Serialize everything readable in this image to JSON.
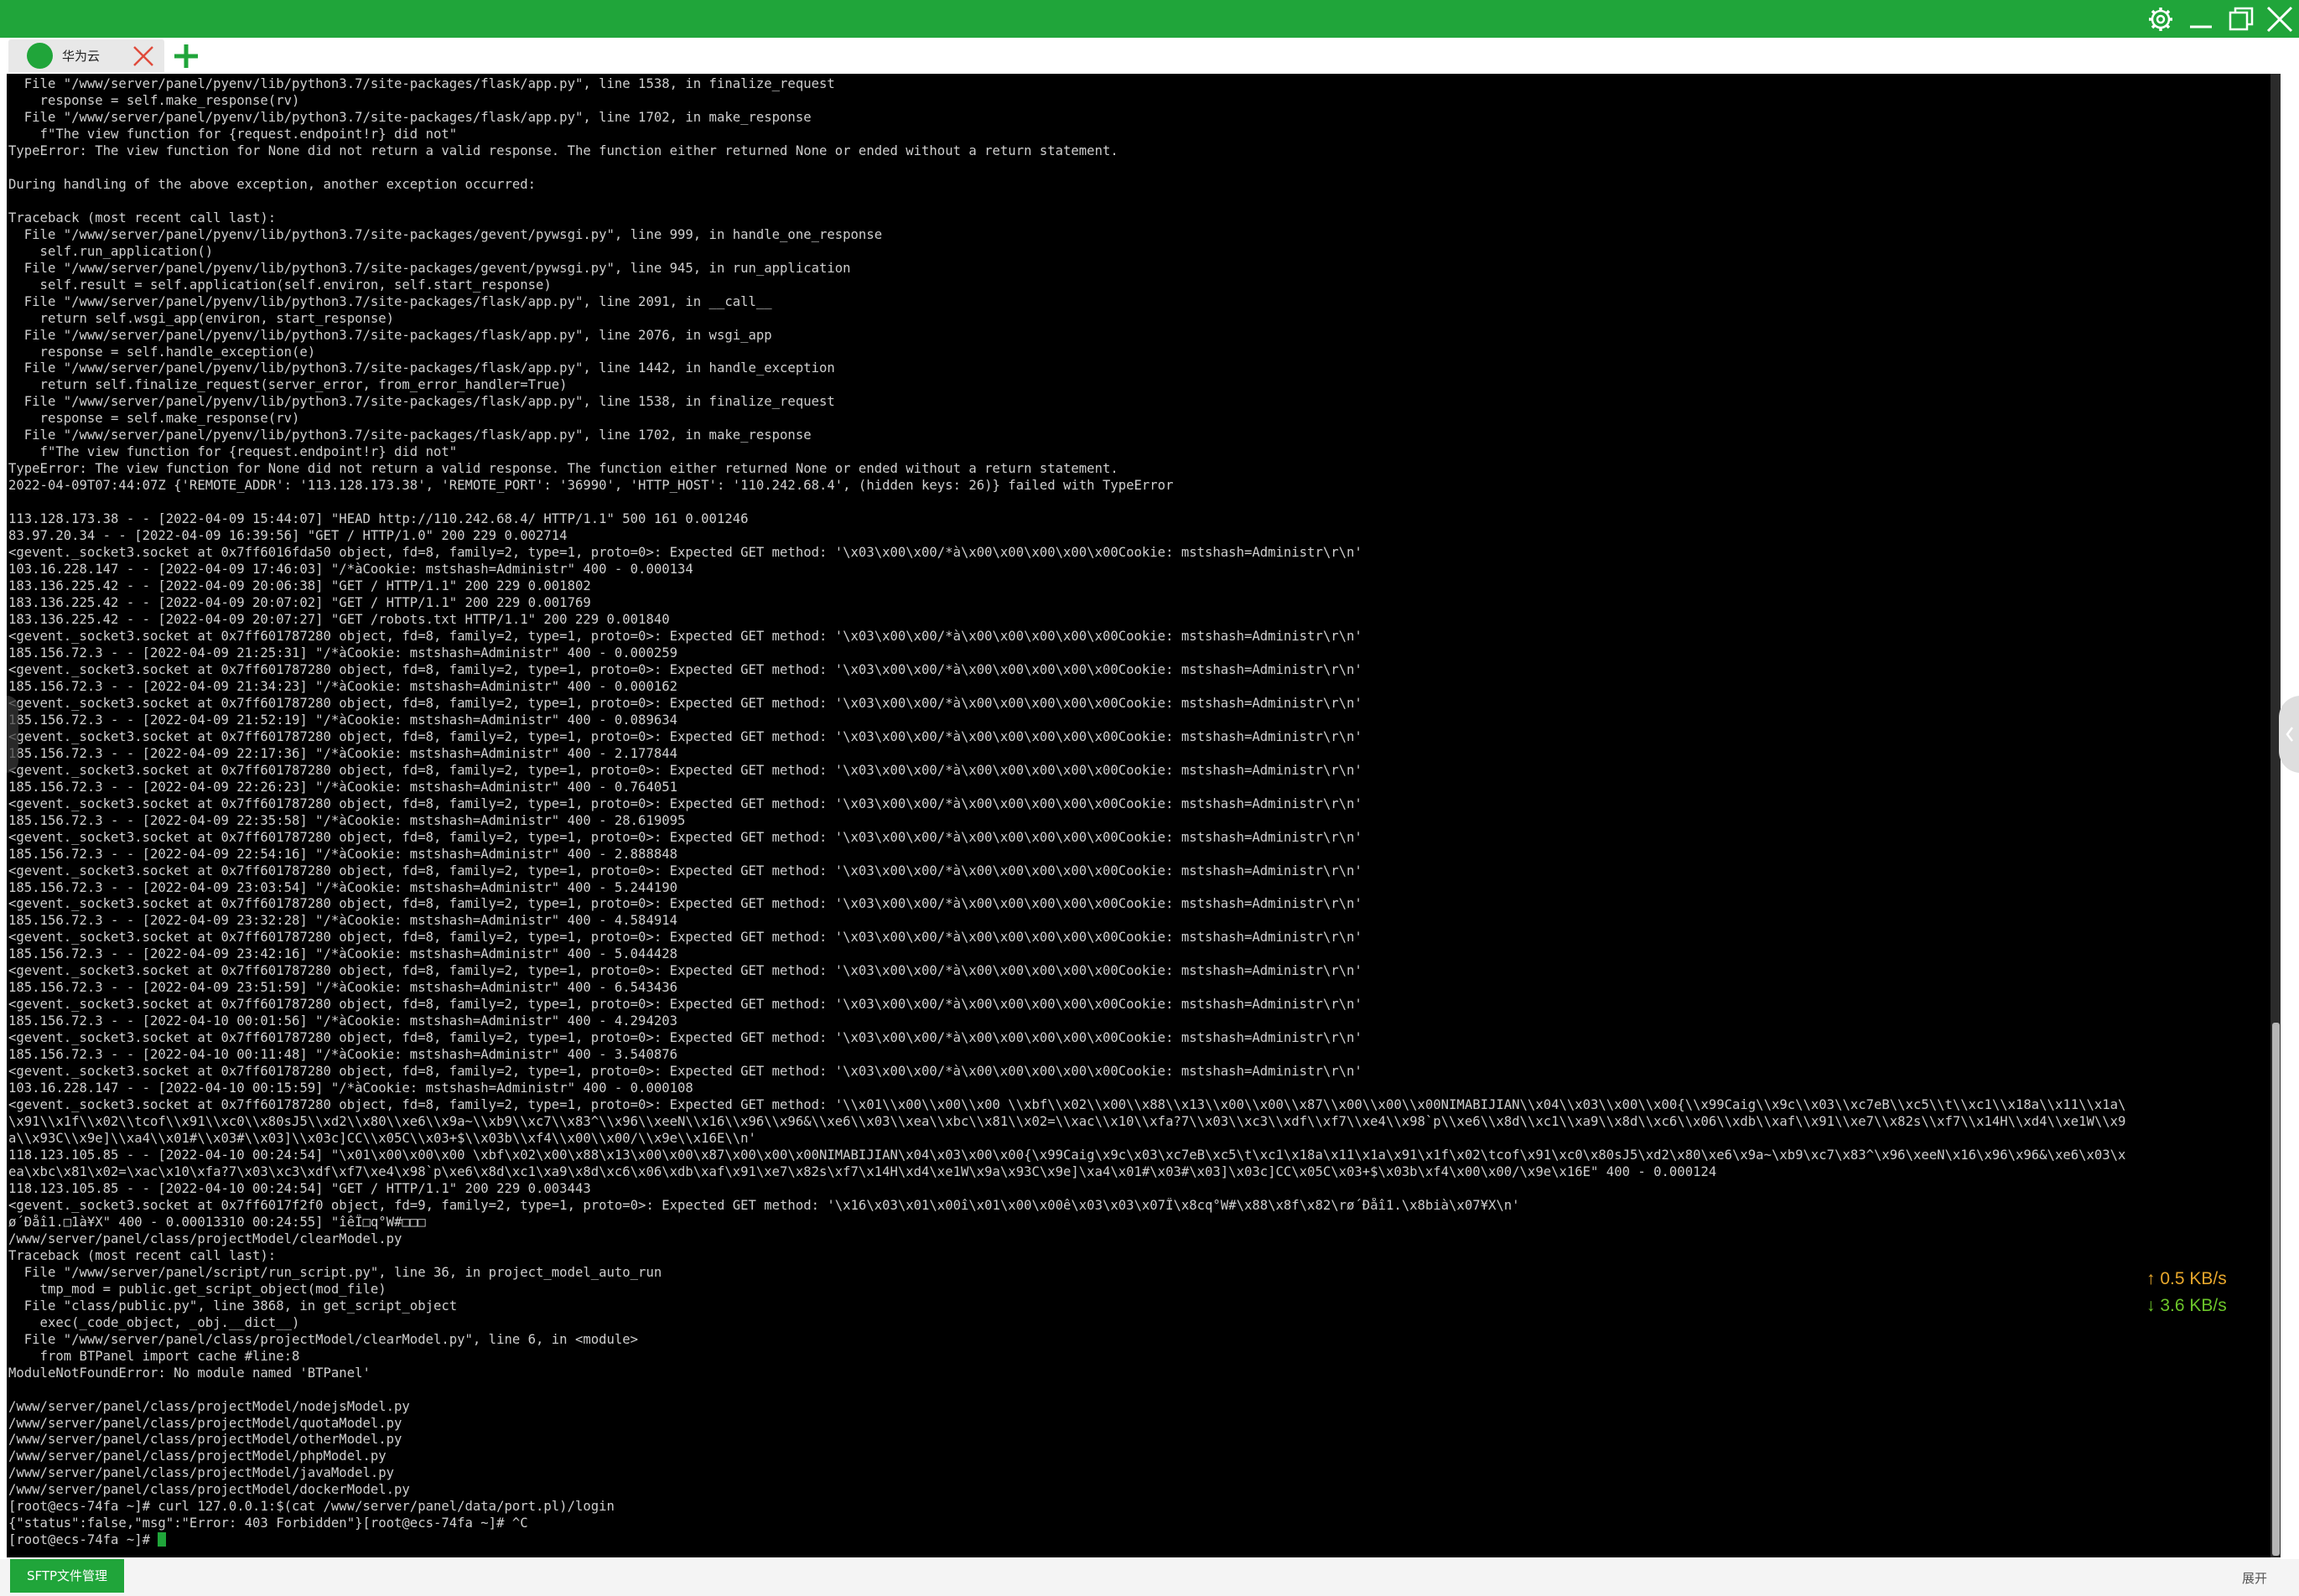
{
  "colors": {
    "accent": "#20a53a",
    "terminal_bg": "#000000",
    "terminal_fg": "#cfcfcf",
    "upload": "#e8a72b",
    "download": "#6cc62a"
  },
  "titlebar": {
    "icons": [
      "gear-icon",
      "minimize-icon",
      "restore-icon",
      "close-icon"
    ]
  },
  "tabs": [
    {
      "label": "华为云",
      "icon": "server-dot-icon",
      "close_icon": "close-icon"
    }
  ],
  "add_tab_icon": "plus-icon",
  "terminal": {
    "lines": [
      "  File \"/www/server/panel/pyenv/lib/python3.7/site-packages/flask/app.py\", line 1538, in finalize_request",
      "    response = self.make_response(rv)",
      "  File \"/www/server/panel/pyenv/lib/python3.7/site-packages/flask/app.py\", line 1702, in make_response",
      "    f\"The view function for {request.endpoint!r} did not\"",
      "TypeError: The view function for None did not return a valid response. The function either returned None or ended without a return statement.",
      "",
      "During handling of the above exception, another exception occurred:",
      "",
      "Traceback (most recent call last):",
      "  File \"/www/server/panel/pyenv/lib/python3.7/site-packages/gevent/pywsgi.py\", line 999, in handle_one_response",
      "    self.run_application()",
      "  File \"/www/server/panel/pyenv/lib/python3.7/site-packages/gevent/pywsgi.py\", line 945, in run_application",
      "    self.result = self.application(self.environ, self.start_response)",
      "  File \"/www/server/panel/pyenv/lib/python3.7/site-packages/flask/app.py\", line 2091, in __call__",
      "    return self.wsgi_app(environ, start_response)",
      "  File \"/www/server/panel/pyenv/lib/python3.7/site-packages/flask/app.py\", line 2076, in wsgi_app",
      "    response = self.handle_exception(e)",
      "  File \"/www/server/panel/pyenv/lib/python3.7/site-packages/flask/app.py\", line 1442, in handle_exception",
      "    return self.finalize_request(server_error, from_error_handler=True)",
      "  File \"/www/server/panel/pyenv/lib/python3.7/site-packages/flask/app.py\", line 1538, in finalize_request",
      "    response = self.make_response(rv)",
      "  File \"/www/server/panel/pyenv/lib/python3.7/site-packages/flask/app.py\", line 1702, in make_response",
      "    f\"The view function for {request.endpoint!r} did not\"",
      "TypeError: The view function for None did not return a valid response. The function either returned None or ended without a return statement.",
      "2022-04-09T07:44:07Z {'REMOTE_ADDR': '113.128.173.38', 'REMOTE_PORT': '36990', 'HTTP_HOST': '110.242.68.4', (hidden keys: 26)} failed with TypeError",
      "",
      "113.128.173.38 - - [2022-04-09 15:44:07] \"HEAD http://110.242.68.4/ HTTP/1.1\" 500 161 0.001246",
      "83.97.20.34 - - [2022-04-09 16:39:56] \"GET / HTTP/1.0\" 200 229 0.002714",
      "<gevent._socket3.socket at 0x7ff6016fda50 object, fd=8, family=2, type=1, proto=0>: Expected GET method: '\\x03\\x00\\x00/*à\\x00\\x00\\x00\\x00\\x00Cookie: mstshash=Administr\\r\\n'",
      "103.16.228.147 - - [2022-04-09 17:46:03] \"/*àCookie: mstshash=Administr\" 400 - 0.000134",
      "183.136.225.42 - - [2022-04-09 20:06:38] \"GET / HTTP/1.1\" 200 229 0.001802",
      "183.136.225.42 - - [2022-04-09 20:07:02] \"GET / HTTP/1.1\" 200 229 0.001769",
      "183.136.225.42 - - [2022-04-09 20:07:27] \"GET /robots.txt HTTP/1.1\" 200 229 0.001840",
      "<gevent._socket3.socket at 0x7ff601787280 object, fd=8, family=2, type=1, proto=0>: Expected GET method: '\\x03\\x00\\x00/*à\\x00\\x00\\x00\\x00\\x00Cookie: mstshash=Administr\\r\\n'",
      "185.156.72.3 - - [2022-04-09 21:25:31] \"/*àCookie: mstshash=Administr\" 400 - 0.000259",
      "<gevent._socket3.socket at 0x7ff601787280 object, fd=8, family=2, type=1, proto=0>: Expected GET method: '\\x03\\x00\\x00/*à\\x00\\x00\\x00\\x00\\x00Cookie: mstshash=Administr\\r\\n'",
      "185.156.72.3 - - [2022-04-09 21:34:23] \"/*àCookie: mstshash=Administr\" 400 - 0.000162",
      "<gevent._socket3.socket at 0x7ff601787280 object, fd=8, family=2, type=1, proto=0>: Expected GET method: '\\x03\\x00\\x00/*à\\x00\\x00\\x00\\x00\\x00Cookie: mstshash=Administr\\r\\n'",
      "185.156.72.3 - - [2022-04-09 21:52:19] \"/*àCookie: mstshash=Administr\" 400 - 0.089634",
      "<gevent._socket3.socket at 0x7ff601787280 object, fd=8, family=2, type=1, proto=0>: Expected GET method: '\\x03\\x00\\x00/*à\\x00\\x00\\x00\\x00\\x00Cookie: mstshash=Administr\\r\\n'",
      "185.156.72.3 - - [2022-04-09 22:17:36] \"/*àCookie: mstshash=Administr\" 400 - 2.177844",
      "<gevent._socket3.socket at 0x7ff601787280 object, fd=8, family=2, type=1, proto=0>: Expected GET method: '\\x03\\x00\\x00/*à\\x00\\x00\\x00\\x00\\x00Cookie: mstshash=Administr\\r\\n'",
      "185.156.72.3 - - [2022-04-09 22:26:23] \"/*àCookie: mstshash=Administr\" 400 - 0.764051",
      "<gevent._socket3.socket at 0x7ff601787280 object, fd=8, family=2, type=1, proto=0>: Expected GET method: '\\x03\\x00\\x00/*à\\x00\\x00\\x00\\x00\\x00Cookie: mstshash=Administr\\r\\n'",
      "185.156.72.3 - - [2022-04-09 22:35:58] \"/*àCookie: mstshash=Administr\" 400 - 28.619095",
      "<gevent._socket3.socket at 0x7ff601787280 object, fd=8, family=2, type=1, proto=0>: Expected GET method: '\\x03\\x00\\x00/*à\\x00\\x00\\x00\\x00\\x00Cookie: mstshash=Administr\\r\\n'",
      "185.156.72.3 - - [2022-04-09 22:54:16] \"/*àCookie: mstshash=Administr\" 400 - 2.888848",
      "<gevent._socket3.socket at 0x7ff601787280 object, fd=8, family=2, type=1, proto=0>: Expected GET method: '\\x03\\x00\\x00/*à\\x00\\x00\\x00\\x00\\x00Cookie: mstshash=Administr\\r\\n'",
      "185.156.72.3 - - [2022-04-09 23:03:54] \"/*àCookie: mstshash=Administr\" 400 - 5.244190",
      "<gevent._socket3.socket at 0x7ff601787280 object, fd=8, family=2, type=1, proto=0>: Expected GET method: '\\x03\\x00\\x00/*à\\x00\\x00\\x00\\x00\\x00Cookie: mstshash=Administr\\r\\n'",
      "185.156.72.3 - - [2022-04-09 23:32:28] \"/*àCookie: mstshash=Administr\" 400 - 4.584914",
      "<gevent._socket3.socket at 0x7ff601787280 object, fd=8, family=2, type=1, proto=0>: Expected GET method: '\\x03\\x00\\x00/*à\\x00\\x00\\x00\\x00\\x00Cookie: mstshash=Administr\\r\\n'",
      "185.156.72.3 - - [2022-04-09 23:42:16] \"/*àCookie: mstshash=Administr\" 400 - 5.044428",
      "<gevent._socket3.socket at 0x7ff601787280 object, fd=8, family=2, type=1, proto=0>: Expected GET method: '\\x03\\x00\\x00/*à\\x00\\x00\\x00\\x00\\x00Cookie: mstshash=Administr\\r\\n'",
      "185.156.72.3 - - [2022-04-09 23:51:59] \"/*àCookie: mstshash=Administr\" 400 - 6.543436",
      "<gevent._socket3.socket at 0x7ff601787280 object, fd=8, family=2, type=1, proto=0>: Expected GET method: '\\x03\\x00\\x00/*à\\x00\\x00\\x00\\x00\\x00Cookie: mstshash=Administr\\r\\n'",
      "185.156.72.3 - - [2022-04-10 00:01:56] \"/*àCookie: mstshash=Administr\" 400 - 4.294203",
      "<gevent._socket3.socket at 0x7ff601787280 object, fd=8, family=2, type=1, proto=0>: Expected GET method: '\\x03\\x00\\x00/*à\\x00\\x00\\x00\\x00\\x00Cookie: mstshash=Administr\\r\\n'",
      "185.156.72.3 - - [2022-04-10 00:11:48] \"/*àCookie: mstshash=Administr\" 400 - 3.540876",
      "<gevent._socket3.socket at 0x7ff601787280 object, fd=8, family=2, type=1, proto=0>: Expected GET method: '\\x03\\x00\\x00/*à\\x00\\x00\\x00\\x00\\x00Cookie: mstshash=Administr\\r\\n'",
      "103.16.228.147 - - [2022-04-10 00:15:59] \"/*àCookie: mstshash=Administr\" 400 - 0.000108",
      "<gevent._socket3.socket at 0x7ff601787280 object, fd=8, family=2, type=1, proto=0>: Expected GET method: '\\\\x01\\\\x00\\\\x00\\\\x00 \\\\xbf\\\\x02\\\\x00\\\\x88\\\\x13\\\\x00\\\\x00\\\\x87\\\\x00\\\\x00\\\\x00NIMABIJIAN\\\\x04\\\\x03\\\\x00\\\\x00{\\\\x99Caig\\\\x9c\\\\x03\\\\xc7eB\\\\xc5\\\\t\\\\xc1\\\\x18a\\\\x11\\\\x1a\\",
      "\\x91\\\\x1f\\\\x02\\\\tcof\\\\x91\\\\xc0\\\\x80sJ5\\\\xd2\\\\x80\\\\xe6\\\\x9a~\\\\xb9\\\\xc7\\\\x83^\\\\x96\\\\xeeN\\\\x16\\\\x96\\\\x96&\\\\xe6\\\\x03\\\\xea\\\\xbc\\\\x81\\\\x02=\\\\xac\\\\x10\\\\xfa?7\\\\x03\\\\xc3\\\\xdf\\\\xf7\\\\xe4\\\\x98`p\\\\xe6\\\\x8d\\\\xc1\\\\xa9\\\\x8d\\\\xc6\\\\x06\\\\xdb\\\\xaf\\\\x91\\\\xe7\\\\x82s\\\\xf7\\\\x14H\\\\xd4\\\\xe1W\\\\x9",
      "a\\\\x93C\\\\x9e]\\\\xa4\\\\x01#\\\\x03#\\\\x03]\\\\x03c]CC\\\\x05C\\\\x03+$\\\\x03b\\\\xf4\\\\x00\\\\x00/\\\\x9e\\\\x16E\\\\n'",
      "118.123.105.85 - - [2022-04-10 00:24:54] \"\\x01\\x00\\x00\\x00 \\xbf\\x02\\x00\\x88\\x13\\x00\\x00\\x87\\x00\\x00\\x00NIMABIJIAN\\x04\\x03\\x00\\x00{\\x99Caig\\x9c\\x03\\xc7eB\\xc5\\t\\xc1\\x18a\\x11\\x1a\\x91\\x1f\\x02\\tcof\\x91\\xc0\\x80sJ5\\xd2\\x80\\xe6\\x9a~\\xb9\\xc7\\x83^\\x96\\xeeN\\x16\\x96\\x96&\\xe6\\x03\\x",
      "ea\\xbc\\x81\\x02=\\xac\\x10\\xfa?7\\x03\\xc3\\xdf\\xf7\\xe4\\x98`p\\xe6\\x8d\\xc1\\xa9\\x8d\\xc6\\x06\\xdb\\xaf\\x91\\xe7\\x82s\\xf7\\x14H\\xd4\\xe1W\\x9a\\x93C\\x9e]\\xa4\\x01#\\x03#\\x03]\\x03c]CC\\x05C\\x03+$\\x03b\\xf4\\x00\\x00/\\x9e\\x16E\" 400 - 0.000124",
      "118.123.105.85 - - [2022-04-10 00:24:54] \"GET / HTTP/1.1\" 200 229 0.003443",
      "<gevent._socket3.socket at 0x7ff6017f2f0 object, fd=9, family=2, type=1, proto=0>: Expected GET method: '\\x16\\x03\\x01\\x00î\\x01\\x00\\x00ê\\x03\\x03\\x07Î\\x8cq°W#\\x88\\x8f\\x82\\rø´Ðåî1.\\x8bià\\x07¥X\\n'",
      "ø´Ðåî1.□1à¥X\" 400 - 0.00013310 00:24:55] \"îêÎ□q°W#□□□",
      "/www/server/panel/class/projectModel/clearModel.py",
      "Traceback (most recent call last):",
      "  File \"/www/server/panel/script/run_script.py\", line 36, in project_model_auto_run",
      "    tmp_mod = public.get_script_object(mod_file)",
      "  File \"class/public.py\", line 3868, in get_script_object",
      "    exec(_code_object, _obj.__dict__)",
      "  File \"/www/server/panel/class/projectModel/clearModel.py\", line 6, in <module>",
      "    from BTPanel import cache #line:8",
      "ModuleNotFoundError: No module named 'BTPanel'",
      "",
      "/www/server/panel/class/projectModel/nodejsModel.py",
      "/www/server/panel/class/projectModel/quotaModel.py",
      "/www/server/panel/class/projectModel/otherModel.py",
      "/www/server/panel/class/projectModel/phpModel.py",
      "/www/server/panel/class/projectModel/javaModel.py",
      "/www/server/panel/class/projectModel/dockerModel.py",
      "[root@ecs-74fa ~]# curl 127.0.0.1:$(cat /www/server/panel/data/port.pl)/login",
      "{\"status\":false,\"msg\":\"Error: 403 Forbidden\"}[root@ecs-74fa ~]# ^C"
    ],
    "prompt": "[root@ecs-74fa ~]# "
  },
  "network": {
    "upload": "0.5 KB/s",
    "download": "3.6 KB/s",
    "upload_icon": "arrow-up-icon",
    "download_icon": "arrow-down-icon"
  },
  "bottom": {
    "sftp_label": "SFTP文件管理",
    "expand_label": "展开"
  }
}
